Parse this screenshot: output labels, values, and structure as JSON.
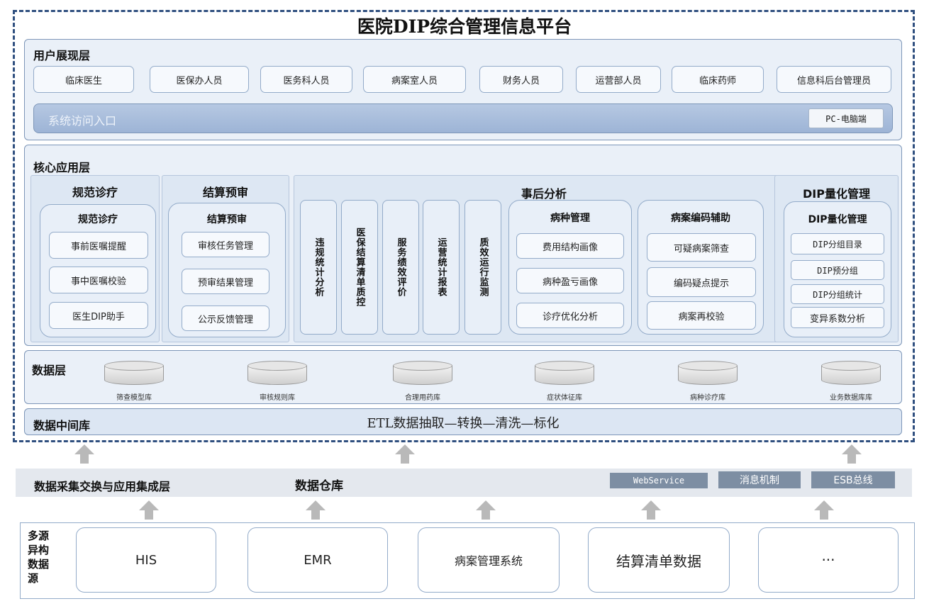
{
  "title": "医院DIP综合管理信息平台",
  "user_layer": {
    "label": "用户展现层",
    "roles": [
      "临床医生",
      "医保办人员",
      "医务科人员",
      "病案室人员",
      "财务人员",
      "运营部人员",
      "临床药师",
      "信息科后台管理员"
    ],
    "access_label": "系统访问入口",
    "access_device": "PC-电脑端"
  },
  "core_layer": {
    "label": "核心应用层",
    "norm": {
      "title": "规范诊疗",
      "inner_title": "规范诊疗",
      "items": [
        "事前医嘱提醒",
        "事中医嘱校验",
        "医生DIP助手"
      ]
    },
    "settle": {
      "title": "结算预审",
      "inner_title": "结算预审",
      "items": [
        "审核任务管理",
        "预审结果管理",
        "公示反馈管理"
      ]
    },
    "post": {
      "title": "事后分析",
      "vertical": [
        "违规统计分析",
        "医保结算清单质控",
        "服务绩效评价",
        "运营统计报表",
        "质效运行监测"
      ],
      "disease": {
        "title": "病种管理",
        "items": [
          "费用结构画像",
          "病种盈亏画像",
          "诊疗优化分析"
        ]
      },
      "coding": {
        "title": "病案编码辅助",
        "items": [
          "可疑病案筛查",
          "编码疑点提示",
          "病案再校验"
        ]
      }
    },
    "dip": {
      "title": "DIP量化管理",
      "inner_title": "DIP量化管理",
      "items": [
        "DIP分组目录",
        "DIP预分组",
        "DIP分组统计",
        "变异系数分析"
      ]
    }
  },
  "data_layer": {
    "label": "数据层",
    "dbs": [
      "筛查模型库",
      "审核规则库",
      "合理用药库",
      "症状体征库",
      "病种诊疗库",
      "业务数据库库"
    ]
  },
  "middle_layer": {
    "label": "数据中间库",
    "etl": "ETL数据抽取—转换—清洗—标化"
  },
  "collect_layer": {
    "label": "数据采集交换与应用集成层",
    "warehouse": "数据仓库",
    "tags": [
      "WebService",
      "消息机制",
      "ESB总线"
    ]
  },
  "source_layer": {
    "label": "多源异构数据源",
    "sources": [
      "HIS",
      "EMR",
      "病案管理系统",
      "结算清单数据",
      "···"
    ]
  }
}
